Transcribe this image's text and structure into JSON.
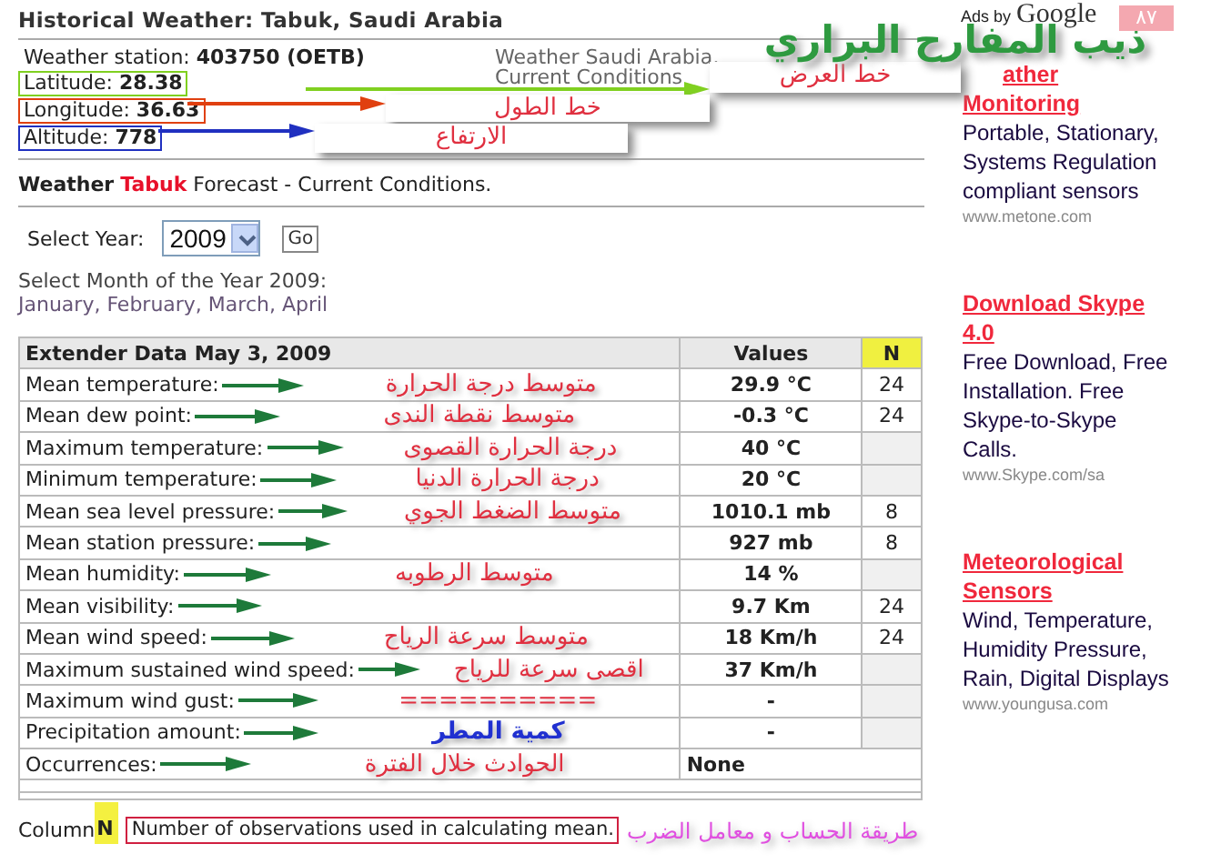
{
  "overlay": {
    "banner": "ذيب المفارح البراري",
    "badge": "٨٧"
  },
  "header": {
    "title": "Historical Weather: Tabuk, Saudi Arabia"
  },
  "station": {
    "label": "Weather station:",
    "value": "403750 (OETB)",
    "side_text": [
      "Weather Saudi Arabia,",
      "Current Conditions"
    ]
  },
  "coords": [
    {
      "label": "Latitude:",
      "value": "28.38",
      "note": "خط العرض",
      "color": "#80d020"
    },
    {
      "label": "Longitude:",
      "value": "36.63",
      "note": "خط الطول",
      "color": "#e04010"
    },
    {
      "label": "Altitude:",
      "value": "778",
      "note": "الارتفاع",
      "color": "#2030c0"
    }
  ],
  "forecast": {
    "lead": "Weather",
    "city": "Tabuk",
    "rest": "Forecast - Current Conditions."
  },
  "year_select": {
    "label": "Select Year:",
    "value": "2009",
    "button": "Go"
  },
  "months": {
    "label": "Select Month of the Year 2009:",
    "links": "January, February, March, April"
  },
  "table": {
    "columns": [
      "Extender Data May 3, 2009",
      "Values",
      "N"
    ],
    "rows": [
      {
        "label": "Mean temperature:",
        "note": "متوسط درجة الحرارة",
        "color": "#e03040",
        "value": "29.9 °C",
        "n": "24"
      },
      {
        "label": "Mean dew point:",
        "note": "متوسط نقطة الندى",
        "color": "#e03040",
        "value": "-0.3 °C",
        "n": "24"
      },
      {
        "label": "Maximum temperature:",
        "note": "درجة الحرارة القصوى",
        "color": "#e03040",
        "value": "40 °C"
      },
      {
        "label": "Minimum temperature:",
        "note": "درجة الحرارة الدنيا",
        "color": "#e03040",
        "value": "20 °C"
      },
      {
        "label": "Mean sea level pressure:",
        "note": "متوسط الضغط الجوي",
        "color": "#e03040",
        "value": "1010.1 mb",
        "n": "8"
      },
      {
        "label": "Mean station pressure:",
        "value": "927 mb",
        "n": "8"
      },
      {
        "label": "Mean humidity:",
        "note": "متوسط الرطوبه",
        "color": "#e03040",
        "value": "14 %"
      },
      {
        "label": "Mean visibility:",
        "value": "9.7 Km",
        "n": "24"
      },
      {
        "label": "Mean wind speed:",
        "note": "متوسط سرعة الرياح",
        "color": "#e03040",
        "value": "18 Km/h",
        "n": "24"
      },
      {
        "label": "Maximum sustained wind speed:",
        "note": "اقصى سرعة للرياح",
        "color": "#e03040",
        "value": "37 Km/h"
      },
      {
        "label": "Maximum wind gust:",
        "note": "==========",
        "color": "#e03040",
        "value": "-"
      },
      {
        "label": "Precipitation amount:",
        "note": "كمية المطر",
        "color": "#2030d0",
        "value": "-"
      },
      {
        "label": "Occurrences:",
        "note": "الحوادث خلال الفترة",
        "color": "#e03040",
        "value": "None",
        "wide": true
      }
    ]
  },
  "footer": {
    "label": "Column",
    "key": "N",
    "text": "Number of observations used in calculating mean.",
    "note": "طريقة الحساب و معامل الضرب"
  },
  "ads_header": {
    "label": "Ads by",
    "brand": "Google"
  },
  "ads": [
    {
      "title": "ather Monitoring",
      "lines": "Portable, Stationary, Systems Regulation compliant sensors",
      "url": "www.metone.com"
    },
    {
      "title": "Download Skype 4.0",
      "lines": "Free Download, Free Installation. Free Skype-to-Skype Calls.",
      "url": "www.Skype.com/sa"
    },
    {
      "title": "Meteorological Sensors",
      "lines": "Wind, Temperature, Humidity Pressure, Rain, Digital Displays",
      "url": "www.youngusa.com"
    }
  ]
}
